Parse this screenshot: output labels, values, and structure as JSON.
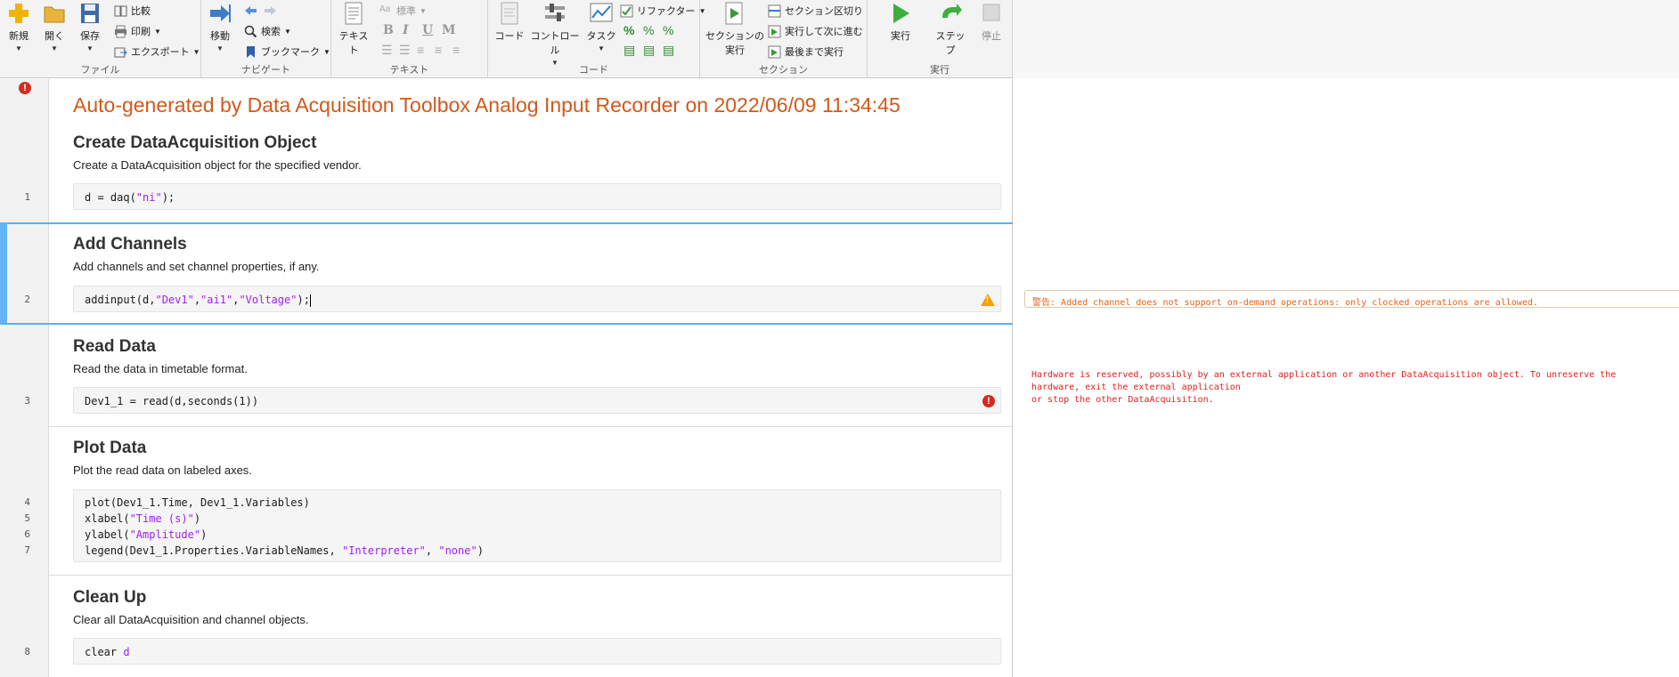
{
  "toolstrip": {
    "file": {
      "group_label": "ファイル",
      "new": "新規",
      "open": "開く",
      "save": "保存",
      "compare": "比較",
      "print": "印刷",
      "export": "エクスポート"
    },
    "navigate": {
      "group_label": "ナビゲート",
      "goto": "移動",
      "find": "検索",
      "bookmark": "ブックマーク"
    },
    "text": {
      "group_label": "テキスト",
      "text_btn": "テキスト",
      "style_select": "標準",
      "bold": "B",
      "italic": "I",
      "underline": "U",
      "mono": "M"
    },
    "code": {
      "group_label": "コード",
      "code_btn": "コード",
      "control_btn": "コントロール",
      "task_btn": "タスク",
      "refactor": "リファクター",
      "percent": "%"
    },
    "section": {
      "group_label": "セクション",
      "run_section_line1": "セクションの",
      "run_section_line2": "実行",
      "section_break": "セクション区切り",
      "run_and_advance": "実行して次に進む",
      "run_to_end": "最後まで実行"
    },
    "run": {
      "group_label": "実行",
      "run": "実行",
      "step": "ステップ",
      "stop": "停止"
    }
  },
  "editor": {
    "title": "Auto-generated by Data Acquisition Toolbox Analog Input Recorder on 2022/06/09 11:34:45",
    "sections": [
      {
        "heading": "Create DataAcquisition Object",
        "description": "Create a DataAcquisition object for the specified vendor.",
        "lines": [
          {
            "num": "1",
            "pre": "d = daq(",
            "str": "\"ni\"",
            "post": ");"
          }
        ]
      },
      {
        "heading": "Add Channels",
        "description": "Add channels and set channel properties, if any.",
        "lines": [
          {
            "num": "2",
            "pre": "addinput(d,",
            "s1": "\"Dev1\"",
            "c1": ",",
            "s2": "\"ai1\"",
            "c2": ",",
            "s3": "\"Voltage\"",
            "post": ");"
          }
        ]
      },
      {
        "heading": "Read Data",
        "description": "Read the data in timetable format.",
        "lines": [
          {
            "num": "3",
            "text": "Dev1_1 = read(d,seconds(1))"
          }
        ]
      },
      {
        "heading": "Plot Data",
        "description": "Plot the read data on labeled axes.",
        "lines": [
          {
            "num": "4",
            "text": "plot(Dev1_1.Time, Dev1_1.Variables)"
          },
          {
            "num": "5",
            "pre": "xlabel(",
            "str": "\"Time (s)\"",
            "post": ")"
          },
          {
            "num": "6",
            "pre": "ylabel(",
            "str": "\"Amplitude\"",
            "post": ")"
          },
          {
            "num": "7",
            "pre": "legend(Dev1_1.Properties.VariableNames, ",
            "s1": "\"Interpreter\"",
            "c1": ", ",
            "s2": "\"none\"",
            "post": ")"
          }
        ]
      },
      {
        "heading": "Clean Up",
        "description": "Clear all DataAcquisition and channel objects.",
        "lines": [
          {
            "num": "8",
            "pre": "clear ",
            "str": "d"
          }
        ]
      }
    ]
  },
  "output": {
    "warning_prefix": "警告:",
    "warning_text": " Added channel does not support on-demand operations: only clocked operations are allowed.",
    "error_line1": "Hardware is reserved, possibly by an external application or another DataAcquisition object. To unreserve the",
    "error_line2": "hardware, exit the external application",
    "error_line3": "or stop the other DataAcquisition."
  },
  "colors": {
    "title": "#d2591a",
    "string": "#a020f0",
    "warning": "#e2611c",
    "error": "#e0201d",
    "active_section": "#64b5f6"
  }
}
